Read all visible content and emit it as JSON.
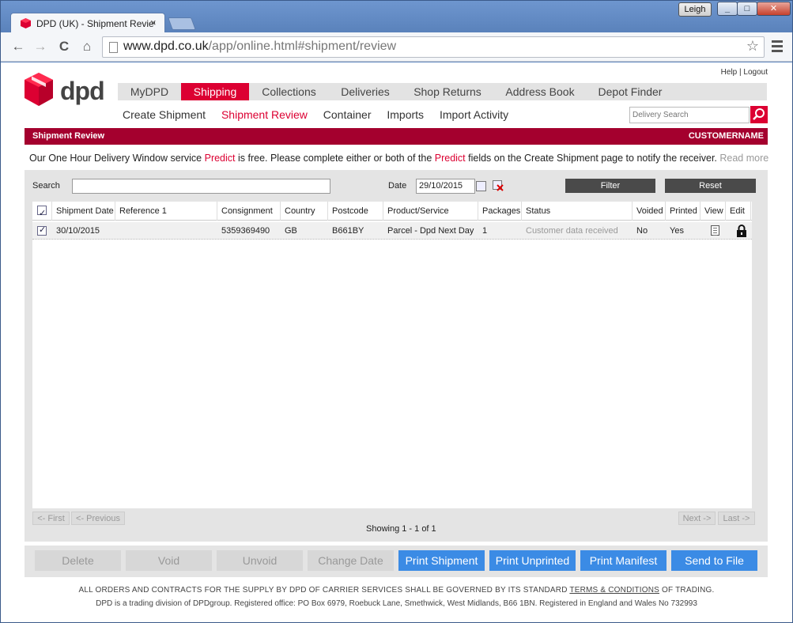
{
  "browser": {
    "tab_title": "DPD (UK) - Shipment Review",
    "tab_close": "×",
    "user": "Leigh",
    "window_min": "_",
    "window_max": "□",
    "window_close": "✕",
    "url_host": "www.dpd.co.uk",
    "url_path": "/app/online.html#shipment/review",
    "back": "←",
    "forward": "→",
    "reload": "C",
    "home": "⌂",
    "star": "☆"
  },
  "header": {
    "logo_text": "dpd",
    "help": "Help",
    "separator": "|",
    "logout": "Logout",
    "main_nav": [
      "MyDPD",
      "Shipping",
      "Collections",
      "Deliveries",
      "Shop Returns",
      "Address Book",
      "Depot Finder"
    ],
    "active_main": "Shipping",
    "sub_nav": [
      "Create Shipment",
      "Shipment Review",
      "Container",
      "Imports",
      "Import Activity"
    ],
    "active_sub": "Shipment Review",
    "delivery_search_placeholder": "Delivery Search"
  },
  "banner": {
    "title": "Shipment Review",
    "customer": "CUSTOMERNAME"
  },
  "predict_message": {
    "part1": "Our One Hour Delivery Window service ",
    "predict": "Predict",
    "part2": " is free. Please complete either or both of the ",
    "part3": " fields on the Create Shipment page to notify the receiver. ",
    "read_more": "Read more"
  },
  "filters": {
    "search_label": "Search",
    "search_value": "",
    "date_label": "Date",
    "date_value": "29/10/2015",
    "filter_label": "Filter",
    "reset_label": "Reset"
  },
  "grid": {
    "columns": [
      "Shipment Date",
      "Reference 1",
      "Consignment",
      "Country",
      "Postcode",
      "Product/Service",
      "Packages",
      "Status",
      "Voided",
      "Printed",
      "View",
      "Edit"
    ],
    "rows": [
      {
        "date": "30/10/2015",
        "reference": "",
        "consignment": "5359369490",
        "country": "GB",
        "postcode": "B661BY",
        "product": "Parcel - Dpd Next Day",
        "packages": "1",
        "status": "Customer data received",
        "voided": "No",
        "printed": "Yes"
      }
    ]
  },
  "pagination": {
    "first": "<- First",
    "previous": "<- Previous",
    "showing": "Showing 1 - 1 of 1",
    "next": "Next ->",
    "last": "Last ->"
  },
  "actions": {
    "delete": "Delete",
    "void": "Void",
    "unvoid": "Unvoid",
    "change_date": "Change Date",
    "print_shipment": "Print Shipment",
    "print_unprinted": "Print Unprinted",
    "print_manifest": "Print Manifest",
    "send_to_file": "Send to File"
  },
  "footer": {
    "line1_a": "ALL ORDERS AND CONTRACTS FOR THE SUPPLY BY DPD OF CARRIER SERVICES SHALL BE GOVERNED BY ITS STANDARD ",
    "terms": "TERMS & CONDITIONS",
    "line1_b": " OF TRADING.",
    "line2": "DPD is a trading division of DPDgroup. Registered office: PO Box 6979, Roebuck Lane, Smethwick, West Midlands, B66 1BN. Registered in England and Wales No 732993"
  },
  "colors": {
    "brand_red": "#dc0032",
    "banner_red": "#a4002e",
    "action_blue": "#3b8be5"
  }
}
